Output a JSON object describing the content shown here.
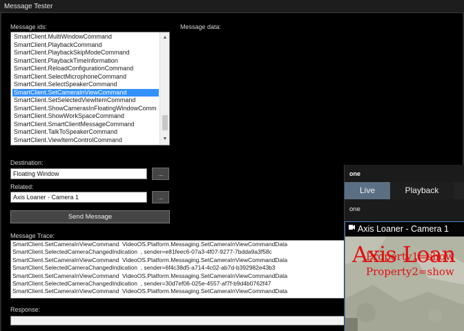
{
  "window": {
    "title": "Message Tester"
  },
  "labels": {
    "message_ids": "Message ids:",
    "message_data": "Message data:",
    "destination": "Destination:",
    "related": "Related:",
    "message_trace": "Message Trace:",
    "response": "Response:"
  },
  "message_ids": {
    "items": [
      "SmartClient.MultiWindowCommand",
      "SmartClient.PlaybackCommand",
      "SmartClient.PlaybackSkipModeCommand",
      "SmartClient.PlaybackTimeInformation",
      "SmartClient.ReloadConfigurationCommand",
      "SmartClient.SelectMicrophoneCommand",
      "SmartClient.SelectSpeakerCommand",
      "SmartClient.SetCameraInViewCommand",
      "SmartClient.SetSelectedViewItemCommand",
      "SmartClient.ShowCamerasInFloatingWindowComm",
      "SmartClient.ShowWorkSpaceCommand",
      "SmartClient.SmartClientMessageCommand",
      "SmartClient.TalkToSpeakerCommand",
      "SmartClient.ViewItemControlCommand"
    ],
    "selected": "SmartClient.SetCameraInViewCommand"
  },
  "destination": {
    "value": "Floating Window",
    "browse_label": "..."
  },
  "related": {
    "value": "Axis Loaner - Camera 1",
    "browse_label": "..."
  },
  "send_button": {
    "label": "Send Message"
  },
  "trace": {
    "lines": [
      "SmartClient.SetCameraInViewCommand  VideoOS.Platform.Messaging.SetCameraInViewCommandData",
      "SmartClient.SelectedCameraChangedIndication  , sender=e81feec6-07a3-4f07-9277-7bdda9a3f58c",
      "SmartClient.SetCameraInViewCommand  VideoOS.Platform.Messaging.SetCameraInViewCommandData",
      "SmartClient.SelectedCameraChangedIndication  , sender=6f4c38d5-a714-4c02-ab7d-b392982e43b3",
      "SmartClient.SetCameraInViewCommand  VideoOS.Platform.Messaging.SetCameraInViewCommandData",
      "SmartClient.SelectedCameraChangedIndication  , sender=30d7ef06-025e-4557-af7f-b9d4b0762f47",
      "SmartClient.SetCameraInViewCommand  VideoOS.Platform.Messaging.SetCameraInViewCommandData"
    ]
  },
  "response": {
    "value": ""
  },
  "floating_window": {
    "title": "one",
    "tabs": [
      {
        "label": "Live",
        "active": true
      },
      {
        "label": "Playback",
        "active": false
      }
    ],
    "view_name": "one",
    "camera": {
      "name": "Axis Loaner - Camera 1",
      "overlay_text": "Axis Loan",
      "overlay_property1": "Property1=show",
      "overlay_property2": "Property2=show"
    }
  },
  "colors": {
    "selection": "#3390ff",
    "live_tab": "#5b6f84",
    "camera_border": "#4b83c2",
    "overlay_text": "#e01010"
  }
}
